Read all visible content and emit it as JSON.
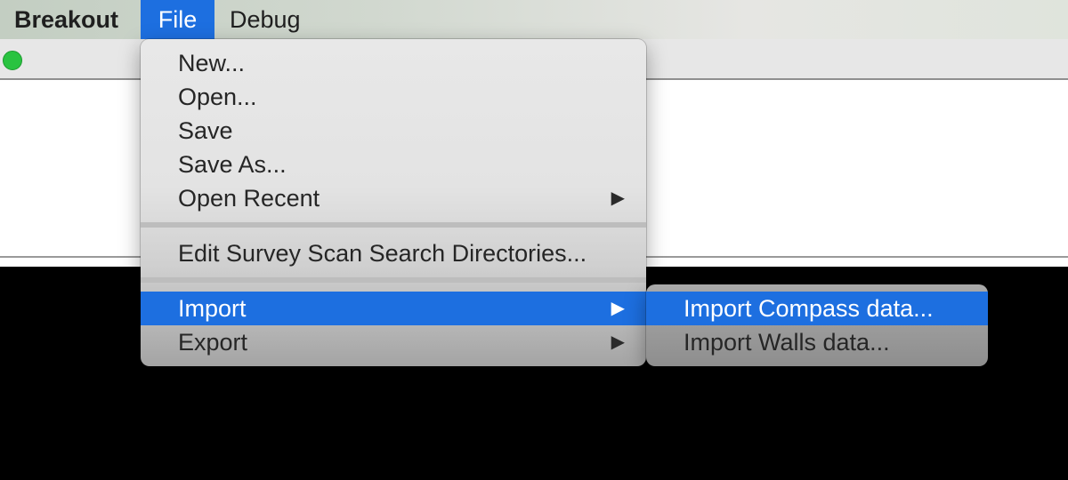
{
  "menubar": {
    "app_name": "Breakout",
    "items": [
      {
        "label": "File"
      },
      {
        "label": "Debug"
      }
    ]
  },
  "file_menu": {
    "items": [
      {
        "label": "New..."
      },
      {
        "label": "Open..."
      },
      {
        "label": "Save"
      },
      {
        "label": "Save As..."
      },
      {
        "label": "Open Recent",
        "submenu_arrow": "▶"
      },
      {
        "label": "Edit Survey Scan Search Directories..."
      },
      {
        "label": "Import",
        "submenu_arrow": "▶"
      },
      {
        "label": "Export",
        "submenu_arrow": "▶"
      }
    ],
    "highlighted": "Import"
  },
  "import_submenu": {
    "items": [
      {
        "label": "Import Compass data..."
      },
      {
        "label": "Import Walls data..."
      }
    ],
    "highlighted": "Import Compass data..."
  },
  "colors": {
    "highlight": "#1d6fe0",
    "canvas": "#000000",
    "traffic_light": "#29c340"
  },
  "icons": [
    "green-traffic-light-icon",
    "submenu-arrow-icon"
  ]
}
